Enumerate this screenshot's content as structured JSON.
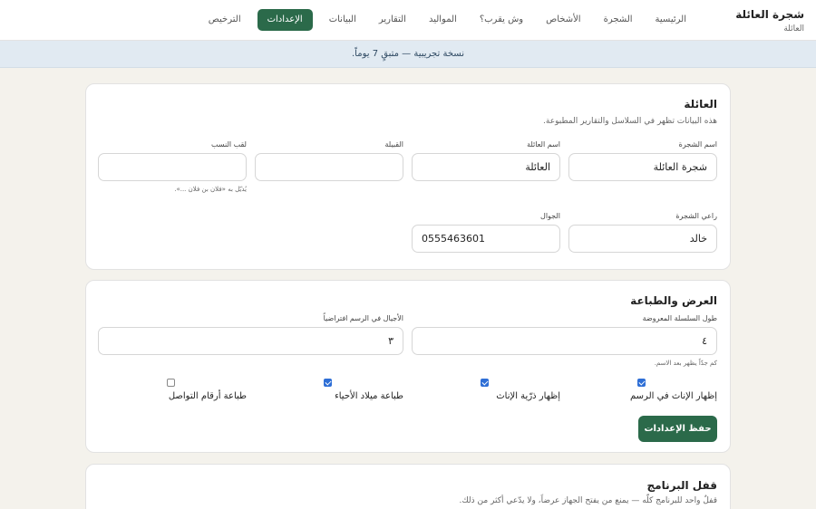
{
  "brand": {
    "title": "شجرة العائلة",
    "subtitle": "العائلة"
  },
  "nav": {
    "items": [
      {
        "label": "الرئيسية",
        "active": false
      },
      {
        "label": "الشجرة",
        "active": false
      },
      {
        "label": "الأشخاص",
        "active": false
      },
      {
        "label": "وش يقرب؟",
        "active": false
      },
      {
        "label": "المواليد",
        "active": false
      },
      {
        "label": "التقارير",
        "active": false
      },
      {
        "label": "البيانات",
        "active": false
      },
      {
        "label": "الإعدادات",
        "active": true
      },
      {
        "label": "الترخيص",
        "active": false
      }
    ]
  },
  "banner": {
    "text": "نسخة تجريبية — متبقٍ 7 يوماً."
  },
  "family_section": {
    "title": "العائلة",
    "description": "هذه البيانات تظهر في السلاسل والتقارير المطبوعة.",
    "tree_name": {
      "label": "اسم الشجرة",
      "value": "شجرة العائلة"
    },
    "family_name": {
      "label": "اسم العائلة",
      "value": "العائلة"
    },
    "tribe": {
      "label": "القبيلة",
      "value": ""
    },
    "lineage_title": {
      "label": "لقب النسب",
      "value": "",
      "hint": "يُذيّل به «فلان بن فلان ...»."
    },
    "sponsor": {
      "label": "راعي الشجرة",
      "value": "خالد"
    },
    "mobile": {
      "label": "الجوال",
      "value": "0555463601"
    }
  },
  "display_section": {
    "title": "العرض والطباعة",
    "chain_length": {
      "label": "طول السلسلة المعروضة",
      "value": "٤",
      "hint": "كم جدّاً يظهر بعد الاسم."
    },
    "default_generations": {
      "label": "الأجيال في الرسم افتراضياً",
      "value": "٣"
    },
    "options": [
      {
        "label": "إظهار الإناث في الرسم",
        "checked": true
      },
      {
        "label": "إظهار ذرّية الإناث",
        "checked": true
      },
      {
        "label": "طباعة ميلاد الأحياء",
        "checked": true
      },
      {
        "label": "طباعة أرقام التواصل",
        "checked": false
      }
    ],
    "save_label": "حفظ الإعدادات"
  },
  "lock_section": {
    "title": "قفل البرنامج",
    "description": "قفلٌ واحد للبرنامج كلّه — يمنع من يفتح الجهاز عرضاً، ولا يدّعي أكثر من ذلك."
  },
  "colors": {
    "accent": "#2b6a4a",
    "banner_bg": "#e1eaf2",
    "page_bg": "#f4f2ec",
    "checkbox": "#2f6fd6"
  }
}
